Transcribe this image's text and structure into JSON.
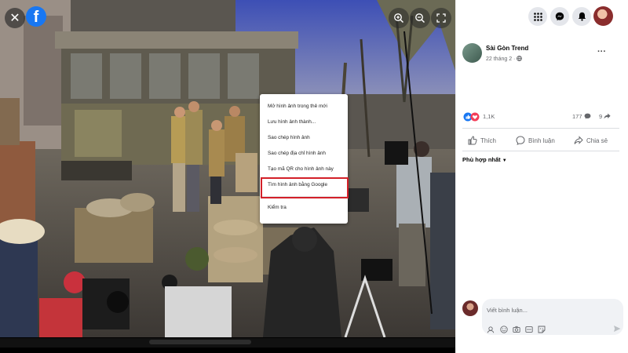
{
  "viewer": {
    "brand_letter": "f"
  },
  "context_menu": {
    "items": [
      "Mở hình ảnh trong thẻ mới",
      "Lưu hình ảnh thành...",
      "Sao chép hình ảnh",
      "Sao chép địa chỉ hình ảnh",
      "Tạo mã QR cho hình ảnh này",
      "Tìm hình ảnh bằng Google"
    ],
    "inspect": "Kiểm tra",
    "highlight_color": "#d32029"
  },
  "post": {
    "page_name": "Sài Gòn Trend",
    "date": "22 tháng 2 · ",
    "reaction_count": "1,1K",
    "comment_count": "177",
    "share_count": "9",
    "actions": {
      "like": "Thích",
      "comment": "Bình luận",
      "share": "Chia sẻ"
    },
    "sort_label": "Phù hợp nhất"
  },
  "comment_box": {
    "placeholder": "Viết bình luận..."
  },
  "colors": {
    "facebook_blue": "#1877f2",
    "like_blue": "#1877f2",
    "love_red": "#f33e58"
  }
}
